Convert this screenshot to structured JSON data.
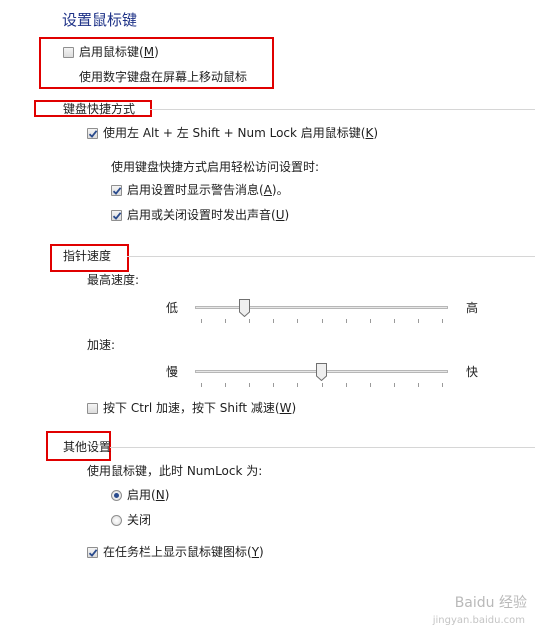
{
  "window": {
    "title": "设置鼠标键"
  },
  "enable": {
    "label": "启用鼠标键",
    "key": "M",
    "checked": false,
    "description": "使用数字键盘在屏幕上移动鼠标"
  },
  "shortcut": {
    "header": "键盘快捷方式",
    "enable_label": "使用左 Alt + 左 Shift + Num Lock 启用鼠标键",
    "enable_key": "K",
    "enable_checked": true,
    "sub_heading": "使用键盘快捷方式启用轻松访问设置时:",
    "warn_label": "启用设置时显示警告消息",
    "warn_key": "A",
    "warn_suffix": "。",
    "warn_checked": true,
    "sound_label": "启用或关闭设置时发出声音",
    "sound_key": "U",
    "sound_checked": true
  },
  "pointer": {
    "header": "指针速度",
    "top_speed": {
      "label": "最高速度:",
      "low": "低",
      "high": "高",
      "value": 0.18
    },
    "acceleration": {
      "label": "加速:",
      "low": "慢",
      "high": "快",
      "value": 0.5
    },
    "ctrl_label": "按下 Ctrl 加速，按下 Shift 减速",
    "ctrl_key": "W",
    "ctrl_checked": false
  },
  "other": {
    "header": "其他设置",
    "numlock_label": "使用鼠标键，此时 NumLock 为:",
    "on_label": "启用",
    "on_key": "N",
    "on_selected": true,
    "off_label": "关闭",
    "taskbar_label": "在任务栏上显示鼠标键图标",
    "taskbar_key": "Y",
    "taskbar_checked": true
  },
  "watermark": {
    "text": "Baidu 经验",
    "url_text": "jingyan.baidu.com"
  },
  "colors": {
    "title": "#1e3287",
    "annotation": "#e00000",
    "check": "#2a4b8d"
  }
}
